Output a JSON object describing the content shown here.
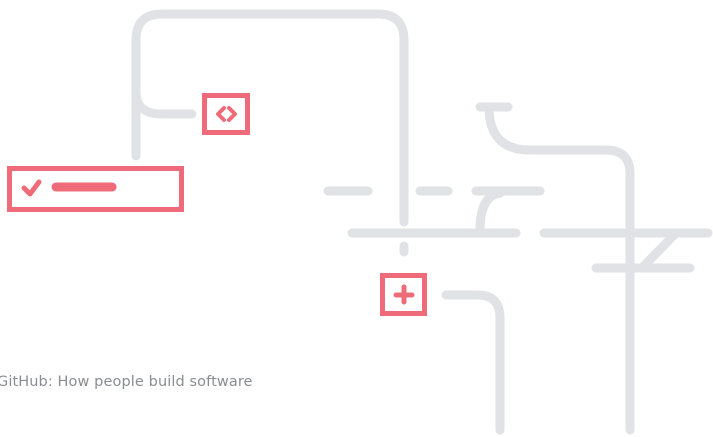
{
  "tagline": "GitHub: How people build software",
  "colors": {
    "line": "#e1e2e6",
    "accent": "#ef6b7a",
    "text": "#8a8d91",
    "background": "#ffffff"
  },
  "icons": [
    "code-icon",
    "check-icon",
    "plus-icon"
  ],
  "progress": {
    "fraction": 0.55
  }
}
